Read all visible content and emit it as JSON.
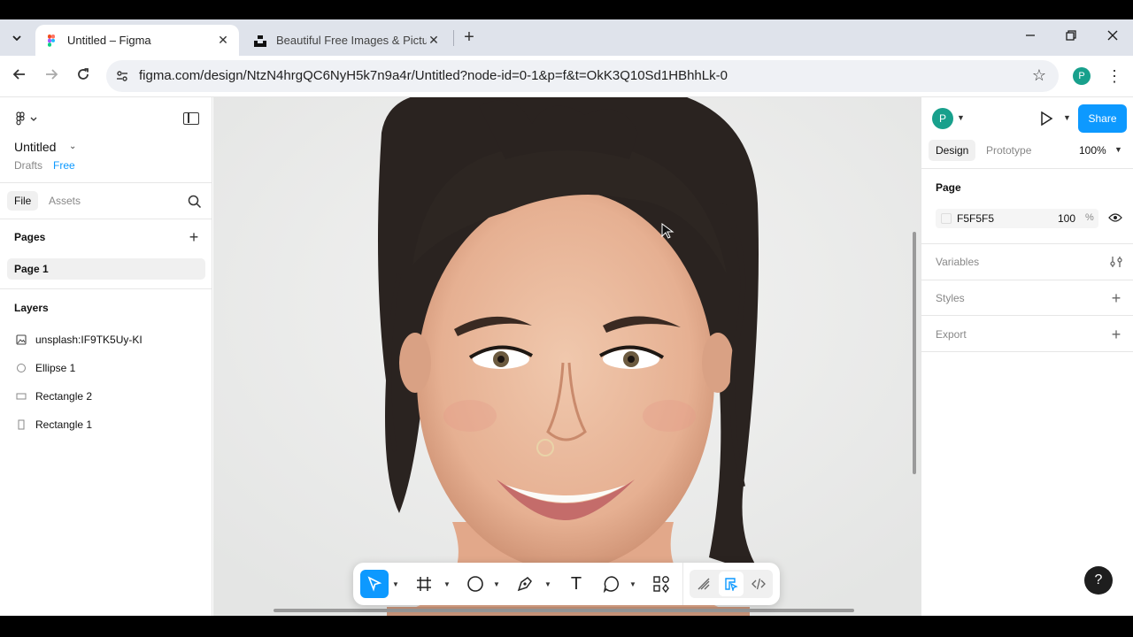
{
  "browser": {
    "tabs": [
      {
        "title": "Untitled – Figma",
        "close": "✕"
      },
      {
        "title": "Beautiful Free Images & Pictures | Unsplash",
        "close": "✕"
      }
    ],
    "new_tab": "+",
    "url": "figma.com/design/NtzN4hrgQC6NyH5k7n9a4r/Untitled?node-id=0-1&p=f&t=OkK3Q10Sd1HBhhLk-0",
    "profile_initial": "P",
    "accent": "#0d99ff"
  },
  "left_panel": {
    "file_title": "Untitled",
    "breadcrumb_drafts": "Drafts",
    "plan_badge": "Free",
    "tabs": {
      "file": "File",
      "assets": "Assets"
    },
    "pages_label": "Pages",
    "pages": [
      "Page 1"
    ],
    "layers_label": "Layers",
    "layers": [
      {
        "name": "unsplash:IF9TK5Uy-KI",
        "icon": "image-icon"
      },
      {
        "name": "Ellipse 1",
        "icon": "ellipse-icon"
      },
      {
        "name": "Rectangle 2",
        "icon": "rectangle-icon"
      },
      {
        "name": "Rectangle 1",
        "icon": "rectangle-icon"
      }
    ]
  },
  "right_panel": {
    "avatar_initial": "P",
    "share_label": "Share",
    "tabs": {
      "design": "Design",
      "prototype": "Prototype"
    },
    "zoom": "100%",
    "page_label": "Page",
    "page_color": {
      "hex": "F5F5F5",
      "opacity": "100",
      "unit": "%"
    },
    "sections": {
      "variables": "Variables",
      "styles": "Styles",
      "export": "Export"
    },
    "help": "?"
  },
  "toolbar": {
    "tools": [
      "move-tool",
      "frame-tool",
      "shape-tool",
      "pen-tool",
      "text-tool",
      "comment-tool",
      "actions-tool"
    ],
    "active_tool": "move-tool",
    "text_glyph": "T"
  }
}
